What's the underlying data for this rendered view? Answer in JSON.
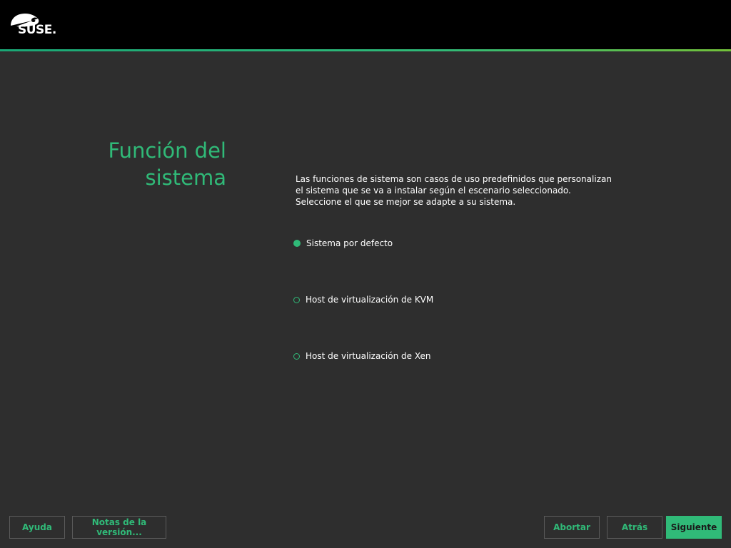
{
  "header": {
    "logo_text": "SUSE."
  },
  "page": {
    "title_line1": "Función del",
    "title_line2": "sistema",
    "description_lines": [
      "Las funciones de sistema son casos de uso predefinidos que personalizan",
      "el sistema que se va a instalar según el escenario seleccionado.",
      "Seleccione el que se mejor se adapte a su sistema."
    ]
  },
  "roles": [
    {
      "label": "Sistema por defecto",
      "selected": true
    },
    {
      "label": "Host de virtualización de KVM",
      "selected": false
    },
    {
      "label": "Host de virtualización de Xen",
      "selected": false
    }
  ],
  "footer": {
    "help_label": "Ayuda",
    "release_notes_label": "Notas de la versión...",
    "abort_label": "Abortar",
    "back_label": "Atrás",
    "next_label": "Siguiente"
  },
  "colors": {
    "accent": "#30ba78",
    "background": "#2e2e2e",
    "header": "#000000"
  }
}
